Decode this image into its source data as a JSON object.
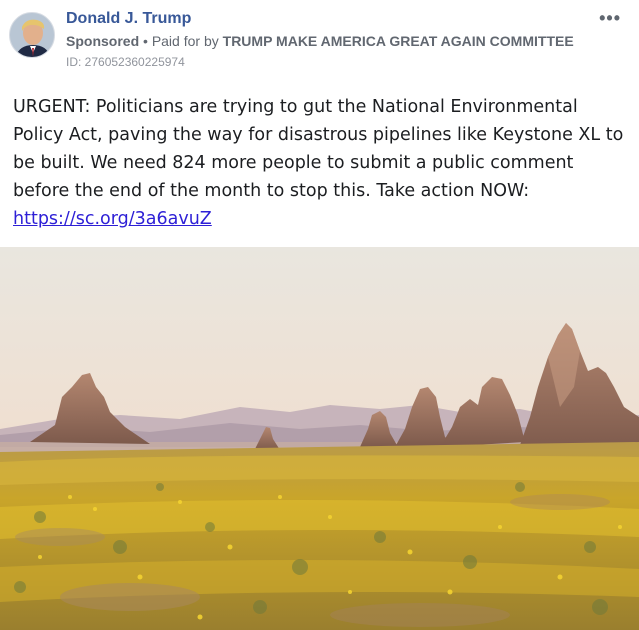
{
  "post": {
    "author": "Donald J. Trump",
    "sponsored_label": "Sponsored",
    "separator": "•",
    "paid_for_prefix": "Paid for by",
    "paid_for_by": "TRUMP MAKE AMERICA GREAT AGAIN COMMITTEE",
    "ad_id": "ID: 276052360225974",
    "more_icon": "more-options-icon",
    "more_glyph": "•••",
    "body": "URGENT: Politicians are trying to gut the National Environmental Policy Act, paving the way for disastrous pipelines like Keystone XL to be built. We need 824 more people to submit a public comment before the end of the month to stop this. Take action NOW:",
    "link": "https://sc.org/3a6avuZ"
  },
  "colors": {
    "author": "#385898",
    "link": "#2d1fd6",
    "meta": "#616770"
  }
}
